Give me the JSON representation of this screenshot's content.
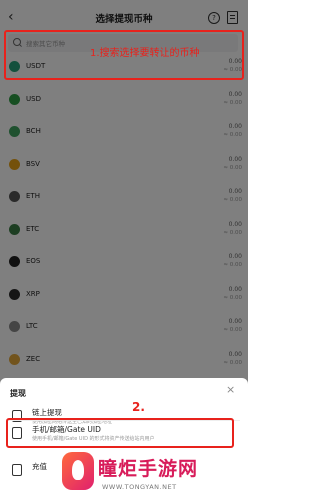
{
  "header": {
    "back_icon": "chevron-left-icon",
    "title": "选择提现币种",
    "help_icon": "help-circle-icon",
    "record_icon": "document-icon"
  },
  "search": {
    "placeholder": "搜索其它币种"
  },
  "annotations": {
    "step1": "1.搜索选择要转让的币种",
    "step2": "2.",
    "color": "#e8221c"
  },
  "coins": [
    {
      "symbol": "USDT",
      "balance": "0.00",
      "fiat": "≈ 0.00",
      "color": "#26a17b"
    },
    {
      "symbol": "USD",
      "balance": "0.00",
      "fiat": "≈ 0.00",
      "color": "#2f9e44"
    },
    {
      "symbol": "BCH",
      "balance": "0.00",
      "fiat": "≈ 0.00",
      "color": "#3ea35f"
    },
    {
      "symbol": "BSV",
      "balance": "0.00",
      "fiat": "≈ 0.00",
      "color": "#e8a317"
    },
    {
      "symbol": "ETH",
      "balance": "0.00",
      "fiat": "≈ 0.00",
      "color": "#555555"
    },
    {
      "symbol": "ETC",
      "balance": "0.00",
      "fiat": "≈ 0.00",
      "color": "#3a7d44"
    },
    {
      "symbol": "EOS",
      "balance": "0.00",
      "fiat": "≈ 0.00",
      "color": "#222222"
    },
    {
      "symbol": "XRP",
      "balance": "0.00",
      "fiat": "≈ 0.00",
      "color": "#2a2a2a"
    },
    {
      "symbol": "LTC",
      "balance": "0.00",
      "fiat": "≈ 0.00",
      "color": "#8a8a8a"
    },
    {
      "symbol": "ZEC",
      "balance": "0.00",
      "fiat": "≈ 0.00",
      "color": "#e5a93a"
    }
  ],
  "sheet": {
    "title": "提现",
    "options": [
      {
        "title": "链上提现",
        "desc": "使用加密网络传送至已知的加密地址",
        "icon": "chain-icon"
      },
      {
        "title": "手机/邮箱/Gate UID",
        "desc": "使用手机/邮箱/Gate UID 的形式将资产传送给站内用户",
        "icon": "user-transfer-icon"
      },
      {
        "title": "充值",
        "desc": "",
        "icon": "deposit-icon"
      }
    ]
  },
  "watermark": {
    "text": "瞳炬手游网",
    "url": "WWW.TONGYAN.NET"
  }
}
